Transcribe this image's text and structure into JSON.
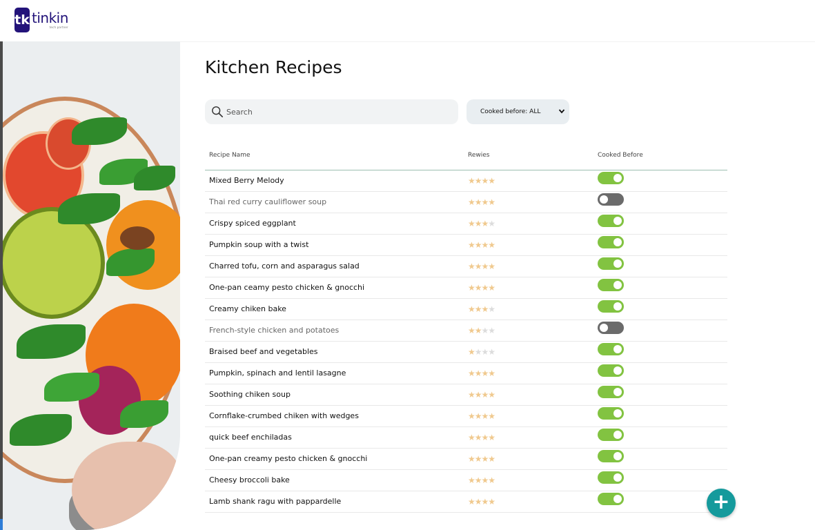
{
  "brand": {
    "logo_mark": "tk",
    "name": "tinkin",
    "tagline": "tech partner"
  },
  "page": {
    "title": "Kitchen Recipes"
  },
  "search": {
    "placeholder": "Search",
    "value": ""
  },
  "filter": {
    "label": "Cooked before: ALL",
    "options": [
      "Cooked before: ALL"
    ]
  },
  "table": {
    "headers": {
      "name": "Recipe Name",
      "reviews": "Rewies",
      "cooked": "Cooked Before"
    },
    "rows": [
      {
        "name": "Mixed Berry Melody",
        "rating": 4,
        "cooked": true
      },
      {
        "name": "Thai red curry cauliflower soup",
        "rating": 4,
        "cooked": false
      },
      {
        "name": "Crispy spiced eggplant",
        "rating": 3,
        "cooked": true
      },
      {
        "name": "Pumpkin soup with a twist",
        "rating": 4,
        "cooked": true
      },
      {
        "name": "Charred tofu, corn and asparagus salad",
        "rating": 4,
        "cooked": true
      },
      {
        "name": "One-pan ceamy pesto chicken & gnocchi",
        "rating": 4,
        "cooked": true
      },
      {
        "name": "Creamy chiken bake",
        "rating": 3,
        "cooked": true
      },
      {
        "name": "French-style chicken and potatoes",
        "rating": 2,
        "cooked": false
      },
      {
        "name": "Braised beef and vegetables",
        "rating": 1,
        "cooked": true
      },
      {
        "name": "Pumpkin, spinach and lentil lasagne",
        "rating": 4,
        "cooked": true
      },
      {
        "name": "Soothing chiken soup",
        "rating": 4,
        "cooked": true
      },
      {
        "name": "Cornflake-crumbed chiken with wedges",
        "rating": 4,
        "cooked": true
      },
      {
        "name": "quick beef enchiladas",
        "rating": 4,
        "cooked": true
      },
      {
        "name": "One-pan creamy pesto chicken & gnocchi",
        "rating": 4,
        "cooked": true
      },
      {
        "name": "Cheesy broccoli bake",
        "rating": 4,
        "cooked": true
      },
      {
        "name": "Lamb shank ragu with pappardelle",
        "rating": 4,
        "cooked": true
      }
    ],
    "max_rating": 4
  },
  "fab": {
    "icon": "plus-icon",
    "symbol": "+"
  },
  "colors": {
    "brand": "#23137a",
    "toggle_on": "#82c341",
    "toggle_off": "#6b6b6b",
    "star": "#f0c98e",
    "fab": "#159a9c"
  },
  "icons": {
    "search": "search-icon",
    "chevron": "chevron-down-icon"
  }
}
